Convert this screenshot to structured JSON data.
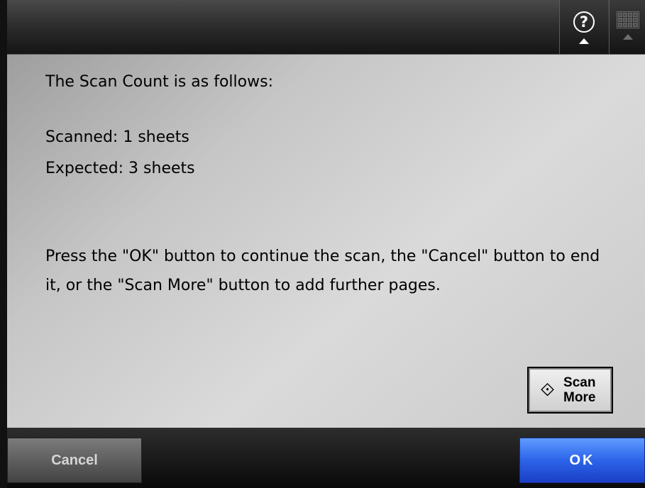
{
  "header": {
    "help_icon_glyph": "?",
    "help_icon": "help-icon",
    "keyboard_icon": "keyboard-icon"
  },
  "message": {
    "title": "The Scan Count is as follows:",
    "scanned": "Scanned: 1 sheets",
    "expected": "Expected: 3 sheets",
    "instructions": "Press the \"OK\" button to continue the scan, the \"Cancel\" button to end it, or the \"Scan More\" button to add further pages."
  },
  "scan_more": {
    "icon": "diamond-start-icon",
    "icon_glyph": "⟐",
    "label_line1": "Scan",
    "label_line2": "More"
  },
  "footer": {
    "cancel_label": "Cancel",
    "ok_label": "OK"
  },
  "colors": {
    "ok_button": "#2c64ea",
    "cancel_button": "#5c5c5c",
    "panel_background": "#cfcfcf"
  }
}
